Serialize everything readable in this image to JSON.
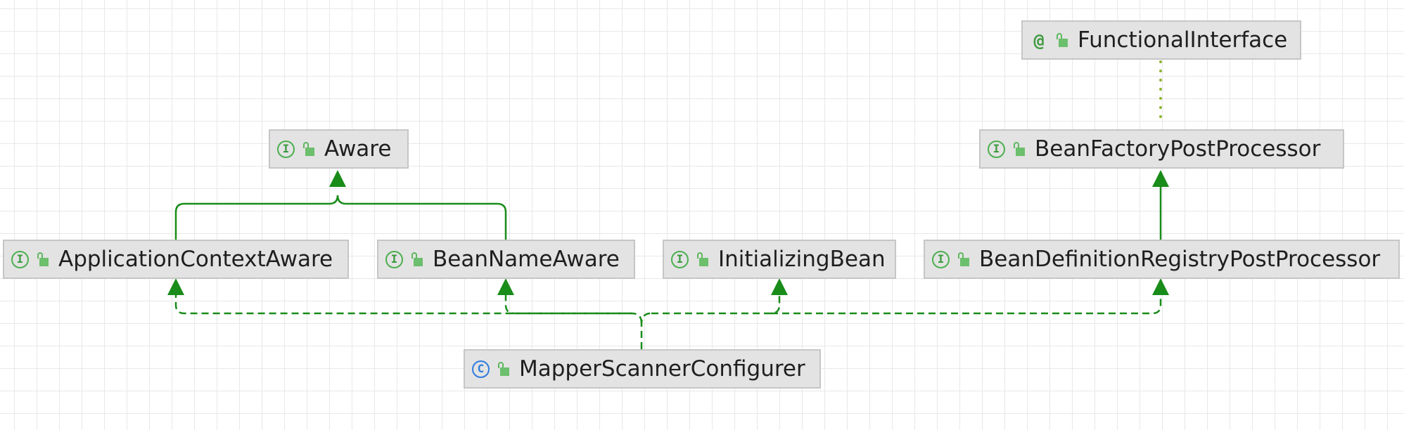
{
  "diagram": {
    "nodes": [
      {
        "id": "functional-interface",
        "label": "FunctionalInterface",
        "kind": "annotation",
        "kind_glyph": "@"
      },
      {
        "id": "aware",
        "label": "Aware",
        "kind": "interface",
        "kind_glyph": "I"
      },
      {
        "id": "bean-factory-post-processor",
        "label": "BeanFactoryPostProcessor",
        "kind": "interface",
        "kind_glyph": "I"
      },
      {
        "id": "application-context-aware",
        "label": "ApplicationContextAware",
        "kind": "interface",
        "kind_glyph": "I"
      },
      {
        "id": "bean-name-aware",
        "label": "BeanNameAware",
        "kind": "interface",
        "kind_glyph": "I"
      },
      {
        "id": "initializing-bean",
        "label": "InitializingBean",
        "kind": "interface",
        "kind_glyph": "I"
      },
      {
        "id": "bean-definition-registry-post-processor",
        "label": "BeanDefinitionRegistryPostProcessor",
        "kind": "interface",
        "kind_glyph": "I"
      },
      {
        "id": "mapper-scanner-configurer",
        "label": "MapperScannerConfigurer",
        "kind": "class",
        "kind_glyph": "C"
      }
    ],
    "edges": [
      {
        "from": "application-context-aware",
        "to": "aware",
        "type": "extends"
      },
      {
        "from": "bean-name-aware",
        "to": "aware",
        "type": "extends"
      },
      {
        "from": "bean-definition-registry-post-processor",
        "to": "bean-factory-post-processor",
        "type": "extends"
      },
      {
        "from": "bean-factory-post-processor",
        "to": "functional-interface",
        "type": "annotated-with"
      },
      {
        "from": "mapper-scanner-configurer",
        "to": "application-context-aware",
        "type": "implements"
      },
      {
        "from": "mapper-scanner-configurer",
        "to": "bean-name-aware",
        "type": "implements"
      },
      {
        "from": "mapper-scanner-configurer",
        "to": "initializing-bean",
        "type": "implements"
      },
      {
        "from": "mapper-scanner-configurer",
        "to": "bean-definition-registry-post-processor",
        "type": "implements"
      }
    ],
    "colors": {
      "edge": "#198c19",
      "annotation_edge": "#8db52e",
      "node_fill": "#e3e3e3",
      "node_border": "#c6c6c6",
      "interface_icon": "#4caf50",
      "class_icon": "#2f7ce0",
      "lock_icon": "#6cbf6c"
    }
  }
}
